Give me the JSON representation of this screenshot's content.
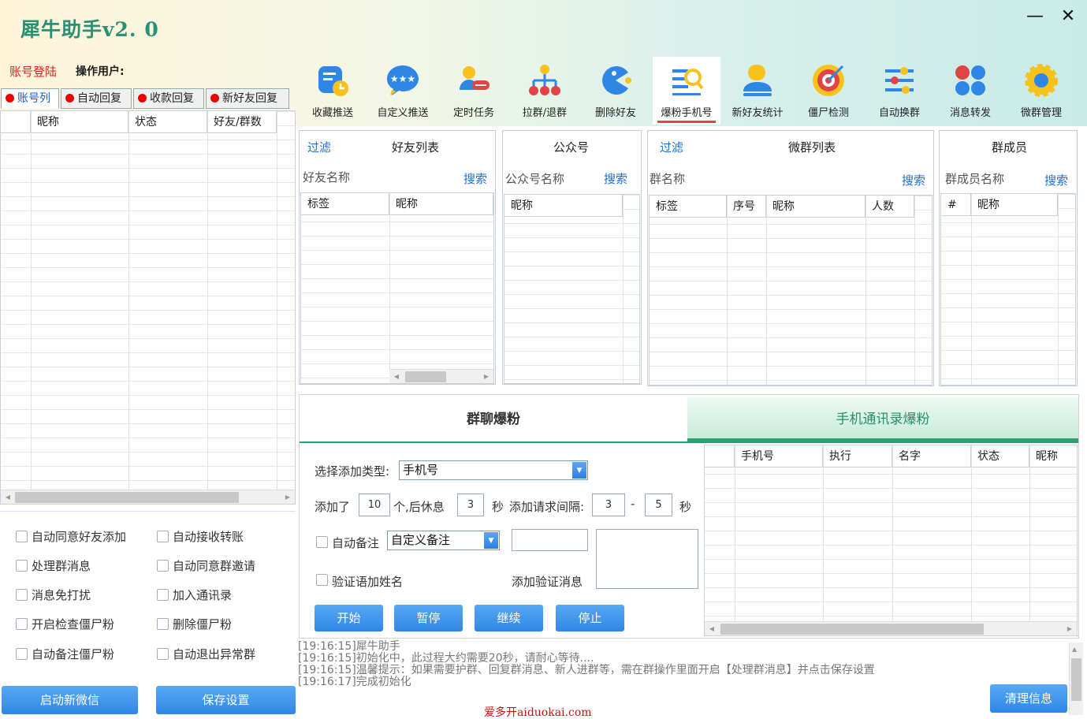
{
  "app": {
    "title": "犀牛助手v2. 0"
  },
  "account": {
    "login_label": "账号登陆",
    "operator_label": "操作用户:"
  },
  "toolbar": [
    {
      "label": "收藏推送",
      "icon": "favorite-push-icon"
    },
    {
      "label": "自定义推送",
      "icon": "chat-bubble-icon"
    },
    {
      "label": "定时任务",
      "icon": "timed-task-icon"
    },
    {
      "label": "拉群/退群",
      "icon": "group-network-icon"
    },
    {
      "label": "删除好友",
      "icon": "pacman-icon"
    },
    {
      "label": "爆粉手机号",
      "icon": "phone-search-icon"
    },
    {
      "label": "新好友统计",
      "icon": "new-friend-icon"
    },
    {
      "label": "僵尸检测",
      "icon": "target-icon"
    },
    {
      "label": "自动换群",
      "icon": "sliders-icon"
    },
    {
      "label": "消息转发",
      "icon": "forward-dots-icon"
    },
    {
      "label": "微群管理",
      "icon": "gear-icon"
    }
  ],
  "left_tabs": [
    "账号列",
    "自动回复",
    "收款回复",
    "新好友回复"
  ],
  "account_table": {
    "columns": [
      "昵称",
      "状态",
      "好友/群数"
    ]
  },
  "options": [
    [
      "自动同意好友添加",
      "自动接收转账"
    ],
    [
      "处理群消息",
      "自动同意群邀请"
    ],
    [
      "消息免打扰",
      "加入通讯录"
    ],
    [
      "开启检查僵尸粉",
      "删除僵尸粉"
    ],
    [
      "自动备注僵尸粉",
      "自动退出异常群"
    ]
  ],
  "bottom_buttons": {
    "start_wechat": "启动新微信",
    "save_settings": "保存设置"
  },
  "friends_panel": {
    "filter": "过滤",
    "title": "好友列表",
    "search_label": "好友名称",
    "search_btn": "搜索",
    "columns": [
      "标签",
      "昵称"
    ]
  },
  "official_panel": {
    "title": "公众号",
    "search_label": "公众号名称",
    "search_btn": "搜索",
    "columns": [
      "昵称"
    ]
  },
  "groups_panel": {
    "filter": "过滤",
    "title": "微群列表",
    "search_label": "群名称",
    "search_btn": "搜索",
    "columns": [
      "标签",
      "序号",
      "昵称",
      "人数"
    ]
  },
  "members_panel": {
    "title": "群成员",
    "search_label": "群成员名称",
    "search_btn": "搜索",
    "columns": [
      "#",
      "昵称"
    ]
  },
  "burst_tabs": [
    "群聊爆粉",
    "手机通讯录爆粉"
  ],
  "burst_form": {
    "type_label": "选择添加类型:",
    "type_value": "手机号",
    "added_label": "添加了",
    "added_count": "10",
    "rest_label": "个,后休息",
    "rest_value": "3",
    "sec_label": "秒",
    "interval_label": "添加请求间隔:",
    "interval_min": "3",
    "dash": "-",
    "interval_max": "5",
    "sec2_label": "秒",
    "auto_remark": "自动备注",
    "remark_value": "自定义备注",
    "verify_name": "验证语加姓名",
    "verify_msg_label": "添加验证消息",
    "buttons": [
      "开始",
      "暂停",
      "继续",
      "停止"
    ]
  },
  "phone_table": {
    "columns": [
      "手机号",
      "执行",
      "名字",
      "状态",
      "昵称"
    ]
  },
  "log": [
    "[19:16:15]犀牛助手",
    "[19:16:15]初始化中，此过程大约需要20秒，请耐心等待....",
    "[19:16:15]温馨提示：如果需要护群、回复群消息、新人进群等，需在群操作里面开启【处理群消息】并点击保存设置",
    "[19:16:17]完成初始化"
  ],
  "clear_button": "清理信息",
  "watermark": "爱多开aiduokai.com"
}
